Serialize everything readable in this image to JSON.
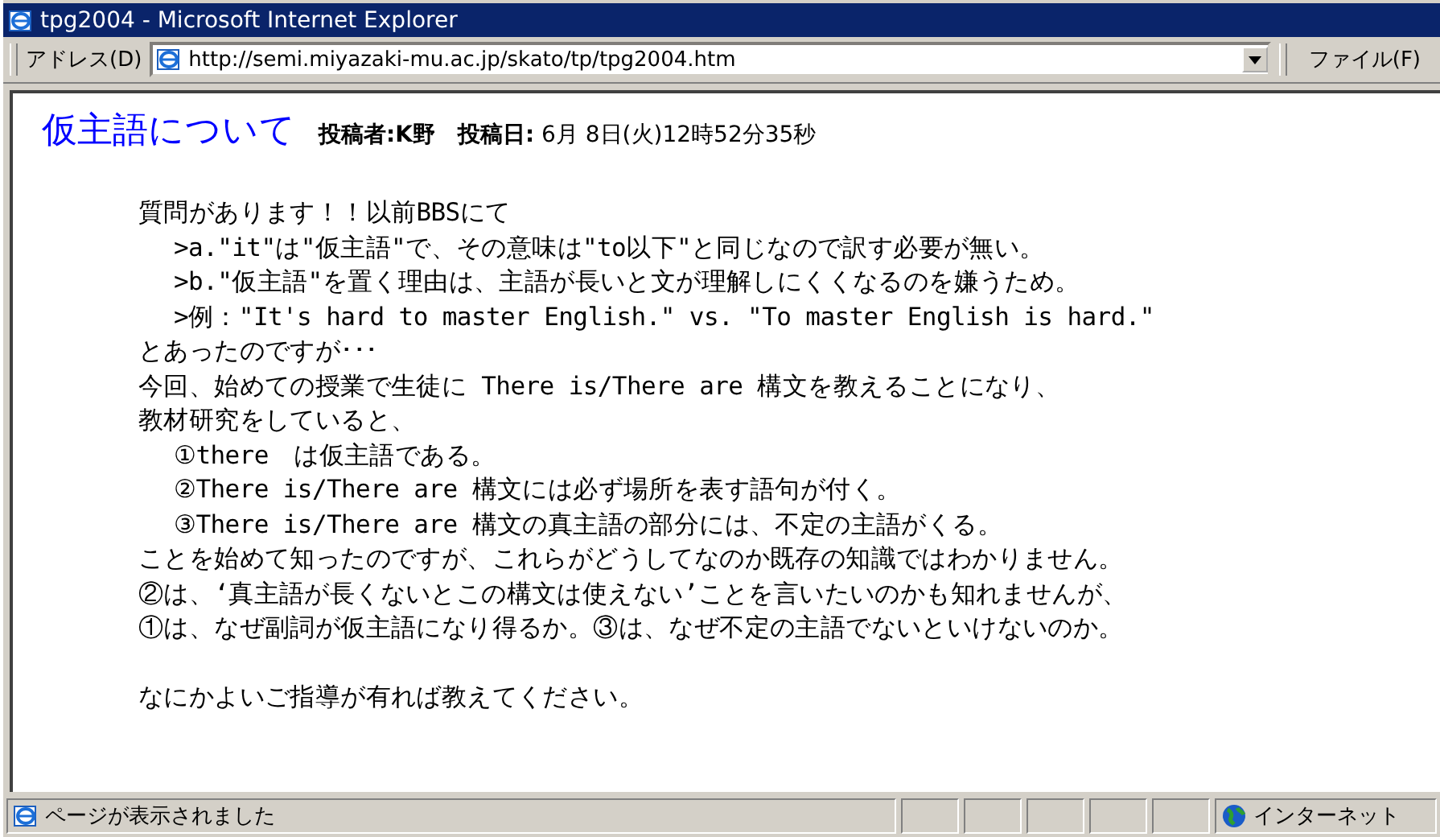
{
  "window": {
    "title": "tpg2004 - Microsoft Internet Explorer"
  },
  "address_bar": {
    "label": "アドレス(D)",
    "value": "http://semi.miyazaki-mu.ac.jp/skato/tp/tpg2004.htm"
  },
  "menu": {
    "label": "ファイル(F)"
  },
  "post": {
    "title": "仮主語について",
    "author_label": "投稿者:",
    "author": "K野",
    "date_label": "投稿日:",
    "date": "6月 8日(火)12時52分35秒",
    "lines": [
      {
        "kind": "plain",
        "text": "質問があります！！以前BBSにて"
      },
      {
        "kind": "indent",
        "text": ">a.\"it\"は\"仮主語\"で、その意味は\"to以下\"と同じなので訳す必要が無い。"
      },
      {
        "kind": "indent",
        "text": ">b.\"仮主語\"を置く理由は、主語が長いと文が理解しにくくなるのを嫌うため。"
      },
      {
        "kind": "indent",
        "text": ">例：\"It's hard to master English.\" vs. \"To master English is hard.\""
      },
      {
        "kind": "plain",
        "text": "とあったのですが･･･"
      },
      {
        "kind": "plain",
        "text": "今回、始めての授業で生徒に There is/There are 構文を教えることになり、"
      },
      {
        "kind": "plain",
        "text": "教材研究をしていると、"
      },
      {
        "kind": "indent",
        "text": "①there　は仮主語である。"
      },
      {
        "kind": "indent",
        "text": "②There is/There are 構文には必ず場所を表す語句が付く。"
      },
      {
        "kind": "indent",
        "text": "③There is/There are 構文の真主語の部分には、不定の主語がくる。"
      },
      {
        "kind": "plain",
        "text": "ことを始めて知ったのですが、これらがどうしてなのか既存の知識ではわかりません。"
      },
      {
        "kind": "plain",
        "text": "②は、‘真主語が長くないとこの構文は使えない’ことを言いたいのかも知れませんが、"
      },
      {
        "kind": "plain",
        "text": "①は、なぜ副詞が仮主語になり得るか。③は、なぜ不定の主語でないといけないのか。"
      },
      {
        "kind": "gap",
        "text": "なにかよいご指導が有れば教えてください。"
      }
    ]
  },
  "status_bar": {
    "text": "ページが表示されました",
    "zone": "インターネット"
  }
}
